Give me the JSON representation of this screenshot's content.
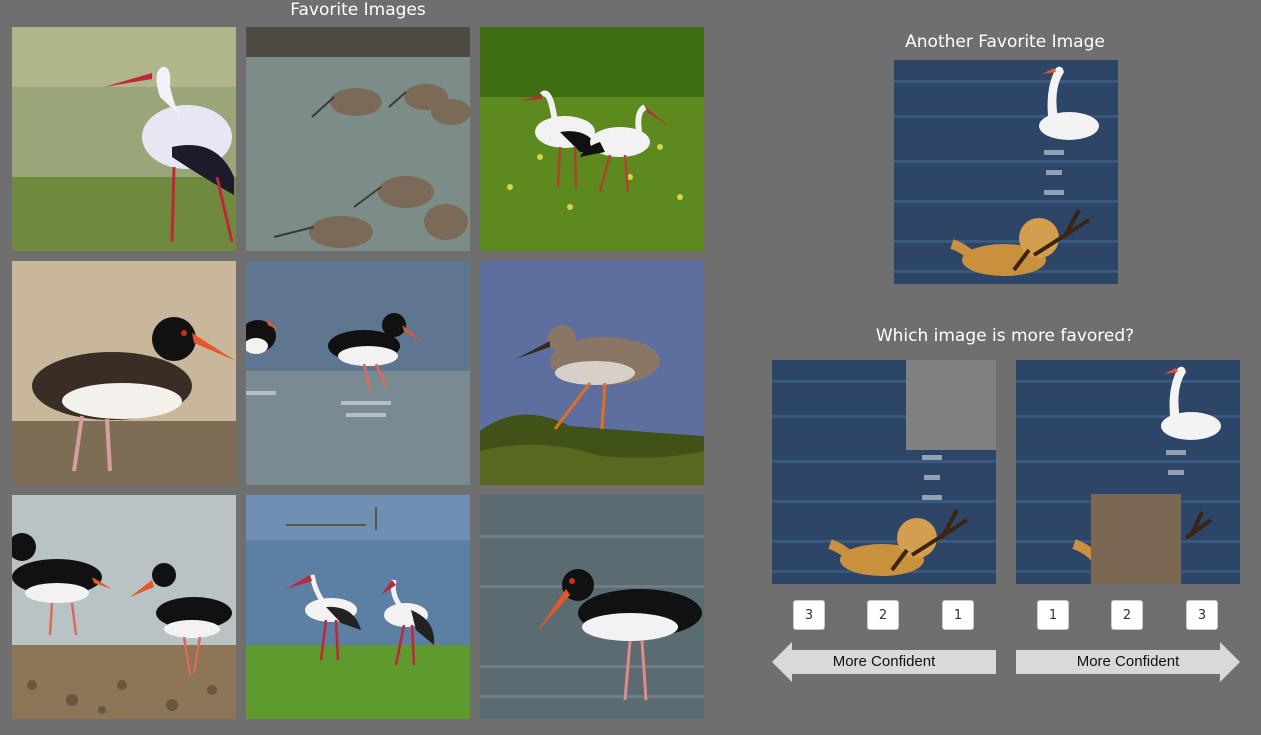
{
  "gallery": {
    "title": "Favorite Images",
    "images": [
      {
        "name": "white-stork-photo"
      },
      {
        "name": "godwits-wading-photo"
      },
      {
        "name": "two-storks-grass-photo"
      },
      {
        "name": "oystercatcher-shore-photo"
      },
      {
        "name": "oystercatchers-water-photo"
      },
      {
        "name": "redshank-rock-photo"
      },
      {
        "name": "oystercatchers-beach-photo"
      },
      {
        "name": "storks-meadow-photo"
      },
      {
        "name": "oystercatcher-water-photo"
      }
    ]
  },
  "another": {
    "title": "Another Favorite Image",
    "image": "swan-and-dog-photo"
  },
  "comparison": {
    "question": "Which image is more favored?",
    "left_image": "swan-dog-occluded-swan",
    "right_image": "swan-dog-occluded-dog",
    "left_buttons": [
      "3",
      "2",
      "1"
    ],
    "right_buttons": [
      "1",
      "2",
      "3"
    ],
    "left_arrow_label": "More Confident",
    "right_arrow_label": "More Confident"
  },
  "colors": {
    "background": "#6f6f6f",
    "arrow": "#d9d9d9",
    "left_occluder": "#808080",
    "right_occluder": "#7a6651"
  }
}
